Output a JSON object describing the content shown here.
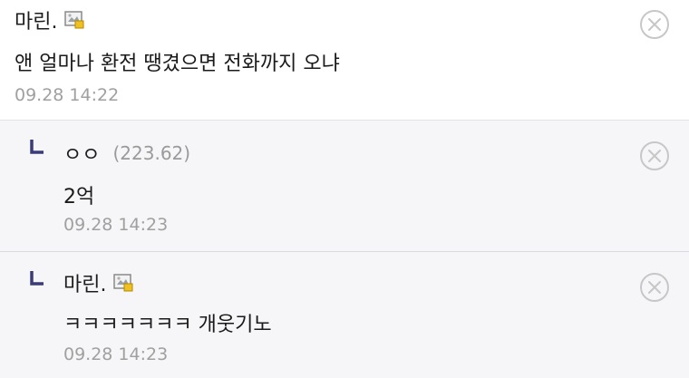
{
  "comments": [
    {
      "author": "마린.",
      "ip": "",
      "content": "앤 얼마나 환전 땡겼으면 전화까지 오냐",
      "time": "09.28 14:22"
    }
  ],
  "replies": [
    {
      "author": "ㅇㅇ",
      "ip": "(223.62)",
      "content": "2억",
      "time": "09.28 14:23"
    },
    {
      "author": "마린.",
      "ip": "",
      "content": "ㅋㅋㅋㅋㅋㅋㅋ 개웃기노",
      "time": "09.28 14:23"
    }
  ],
  "icons": {
    "member": "member-badge-icon",
    "reply": "reply-arrow-icon",
    "delete": "delete-circle-x-icon"
  },
  "colors": {
    "reply_mark": "#3b3b7a",
    "icon_gray": "#c7c7c7",
    "reply_bg": "#f6f6f9",
    "time": "#a0a0a0"
  }
}
